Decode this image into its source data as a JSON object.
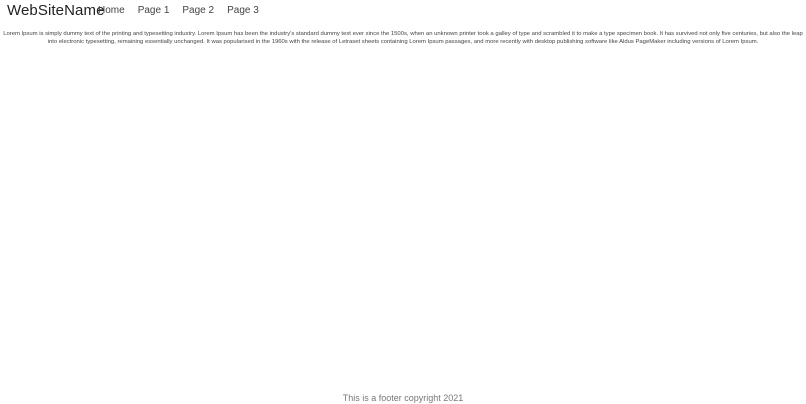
{
  "navbar": {
    "brand": "WebSiteName",
    "links": [
      {
        "label": "Home"
      },
      {
        "label": "Page 1"
      },
      {
        "label": "Page 2"
      },
      {
        "label": "Page 3"
      }
    ]
  },
  "main": {
    "paragraph": "Lorem Ipsum is simply dummy text of the printing and typesetting industry. Lorem Ipsum has been the industry's standard dummy text ever since the 1500s, when an unknown printer took a galley of type and scrambled it to make a type specimen book. It has survived not only five centuries, but also the leap into electronic typesetting, remaining essentially unchanged. It was popularised in the 1960s with the release of Letraset sheets containing Lorem Ipsum passages, and more recently with desktop publishing software like Aldus PageMaker including versions of Lorem Ipsum."
  },
  "footer": {
    "text": "This is a footer copyright 2021"
  }
}
